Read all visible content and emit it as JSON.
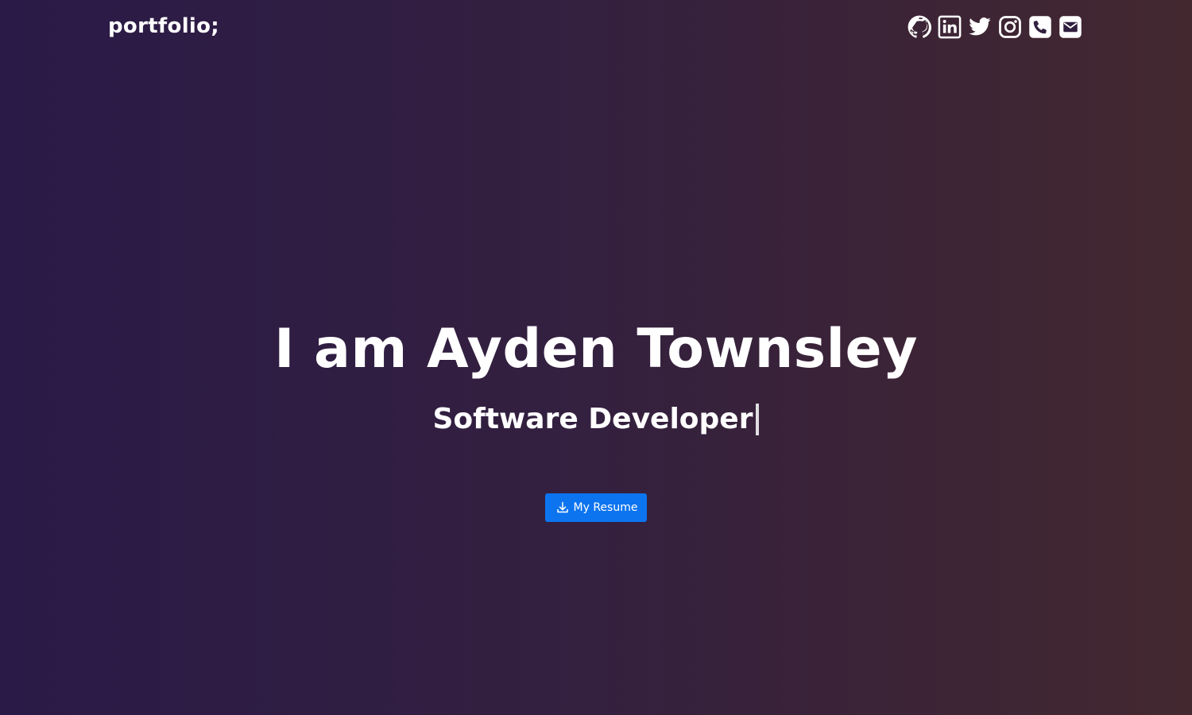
{
  "navbar": {
    "brand": "portfolio;",
    "socials": [
      {
        "icon": "github-icon",
        "label": "GitHub"
      },
      {
        "icon": "linkedin-icon",
        "label": "LinkedIn"
      },
      {
        "icon": "twitter-icon",
        "label": "Twitter"
      },
      {
        "icon": "instagram-icon",
        "label": "Instagram"
      },
      {
        "icon": "phone-icon",
        "label": "Phone"
      },
      {
        "icon": "email-icon",
        "label": "Email"
      }
    ]
  },
  "hero": {
    "headline": "I am Ayden Townsley",
    "subtitle": "Software Developer",
    "resume_button": {
      "label": "My Resume",
      "icon": "download-icon"
    }
  },
  "colors": {
    "gradient_start": "#2a1a47",
    "gradient_end": "#43282f",
    "button": "#0d74f0",
    "text": "#ffffff"
  }
}
